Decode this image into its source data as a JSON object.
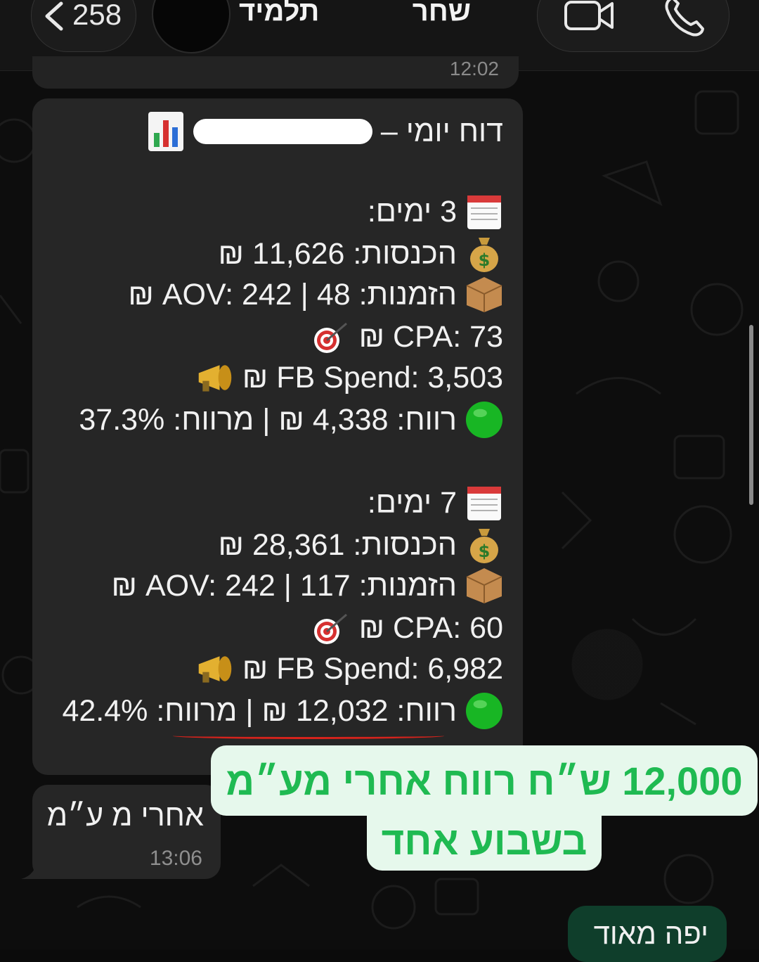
{
  "header": {
    "back_count": "258",
    "contact_name_left": "שחר",
    "contact_name_right": "תלמיד"
  },
  "previous_message": {
    "timestamp": "12:02"
  },
  "report": {
    "title": "דוח יומי –",
    "section1": {
      "period": "3 ימים:",
      "revenue": "הכנסות: 11,626 ₪",
      "orders": "הזמנות: 48 | AOV: 242 ₪",
      "cpa": "CPA: 73 ₪",
      "fb_spend": "FB Spend: 3,503 ₪",
      "profit": "רווח: 4,338 ₪ | מרווח: 37.3%"
    },
    "section2": {
      "period": "7 ימים:",
      "revenue": "הכנסות: 28,361 ₪",
      "orders": "הזמנות: 117 | AOV: 242 ₪",
      "cpa": "CPA: 60 ₪",
      "fb_spend": "FB Spend: 6,982 ₪",
      "profit": "רווח: 12,032 ₪ | מרווח: 42.4%"
    }
  },
  "message_small": {
    "text": "אחרי מ ע״מ",
    "timestamp": "13:06"
  },
  "callout": {
    "line1": "12,000 ש״ח רווח אחרי מע״מ",
    "line2": "בשבוע אחד",
    "color": "#1fba52"
  },
  "outgoing": {
    "text": "יפה מאוד"
  }
}
